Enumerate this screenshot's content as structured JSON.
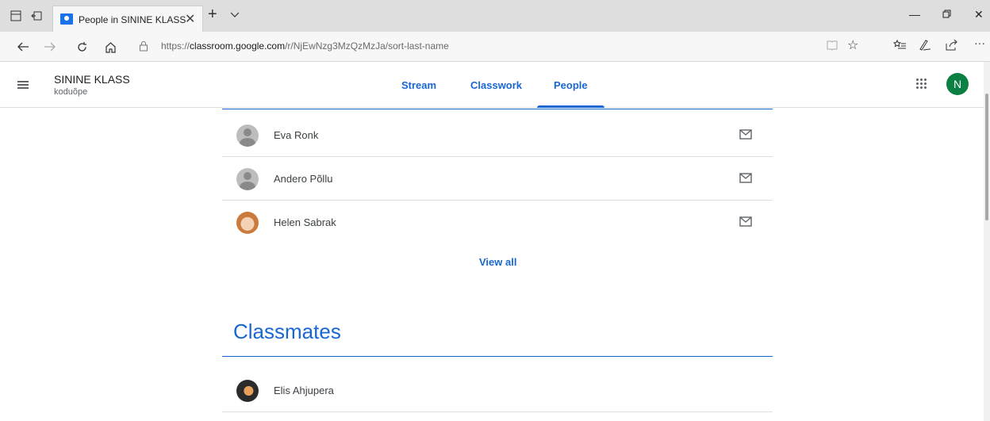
{
  "browser": {
    "tab_title": "People in SININE KLASS",
    "url_prefix": "https://",
    "url_host": "classroom.google.com",
    "url_path": "/r/NjEwNzg3MzQzMzJa/sort-last-name"
  },
  "header": {
    "class_name": "SININE KLASS",
    "class_section": "koduõpe",
    "tabs": [
      "Stream",
      "Classwork",
      "People"
    ],
    "active_tab": "People",
    "account_initial": "N"
  },
  "students_list": [
    {
      "name": "Eva Ronk",
      "avatar": "generic"
    },
    {
      "name": "Andero Põllu",
      "avatar": "generic"
    },
    {
      "name": "Helen Sabrak",
      "avatar": "photo"
    }
  ],
  "view_all_label": "View all",
  "classmates": {
    "title": "Classmates",
    "items": [
      {
        "name": "Elis Ahjupera",
        "avatar": "photo"
      }
    ]
  },
  "colors": {
    "accent": "#1967d2",
    "avatar_account": "#0b8043"
  }
}
